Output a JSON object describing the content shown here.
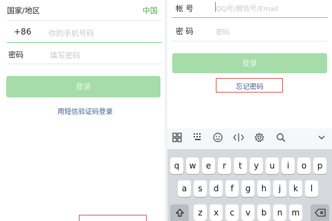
{
  "left": {
    "region_label": "国家/地区",
    "region_value": "中国",
    "phone_prefix": "+86",
    "phone_placeholder": "你的手机号码",
    "password_label": "密码",
    "password_placeholder": "填写密码",
    "login_button": "登录",
    "sms_login_link": "用短信验证码登录"
  },
  "right": {
    "account_label": "帐 号",
    "account_placeholder": "QQ号/微信号/Email",
    "password_label": "密 码",
    "password_placeholder": "密码",
    "login_button": "登录",
    "forgot_password_link": "忘记密码"
  },
  "keyboard": {
    "toolbar_icons": [
      "grid-icon",
      "keypad-icon",
      "emoji-icon",
      "cursor-icon",
      "settings-icon",
      "search-icon",
      "chevron-down-icon"
    ],
    "row1": [
      "q",
      "w",
      "e",
      "r",
      "t",
      "y",
      "u",
      "i",
      "o",
      "p"
    ],
    "row2": [
      "a",
      "s",
      "d",
      "f",
      "g",
      "h",
      "j",
      "k",
      "l"
    ],
    "row3": [
      "z",
      "x",
      "c",
      "v",
      "b",
      "n",
      "m"
    ],
    "shift_icon": "shift-icon",
    "backspace_icon": "backspace-icon"
  },
  "colors": {
    "accent_green": "#4caf50",
    "button_green": "#a5dca9",
    "highlight_red": "#d9534f"
  }
}
